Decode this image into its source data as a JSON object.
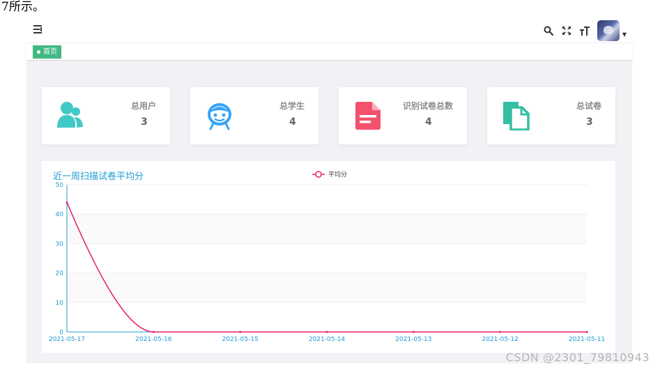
{
  "caption": "7所示。",
  "navbar": {
    "menu_icon": "hamburger-fold-icon",
    "icons": [
      "search-icon",
      "fullscreen-icon",
      "font-size-icon"
    ],
    "avatar_icon": "user-avatar",
    "caret_icon": "caret-down-icon"
  },
  "tags": {
    "home": "首页"
  },
  "cards": [
    {
      "label": "总用户",
      "value": "3",
      "icon": "peoples-icon",
      "color": "#40c9c6"
    },
    {
      "label": "总学生",
      "value": "4",
      "icon": "robot-face-icon",
      "color": "#36a3f7"
    },
    {
      "label": "识别试卷总数",
      "value": "4",
      "icon": "document-icon",
      "color": "#f4516c"
    },
    {
      "label": "总试卷",
      "value": "3",
      "icon": "copy-icon",
      "color": "#34bfa3"
    }
  ],
  "chart_data": {
    "type": "line",
    "title": "近一周扫描试卷平均分",
    "legend": [
      "平均分"
    ],
    "legend_position": "top-center",
    "categories": [
      "2021-05-17",
      "2021-05-16",
      "2021-05-15",
      "2021-05-14",
      "2021-05-13",
      "2021-05-12",
      "2021-05-11"
    ],
    "series": [
      {
        "name": "平均分",
        "values": [
          44,
          0,
          0,
          0,
          0,
          0,
          0
        ],
        "color": "#e91e63"
      }
    ],
    "ylim": [
      0,
      50
    ],
    "yticks": [
      "0",
      "10",
      "20",
      "30",
      "40",
      "50"
    ],
    "grid": true,
    "smooth": true,
    "axis_color": "#1f9bd4",
    "title_color": "#1f9bd4"
  },
  "watermark": "CSDN @2301_79810943"
}
